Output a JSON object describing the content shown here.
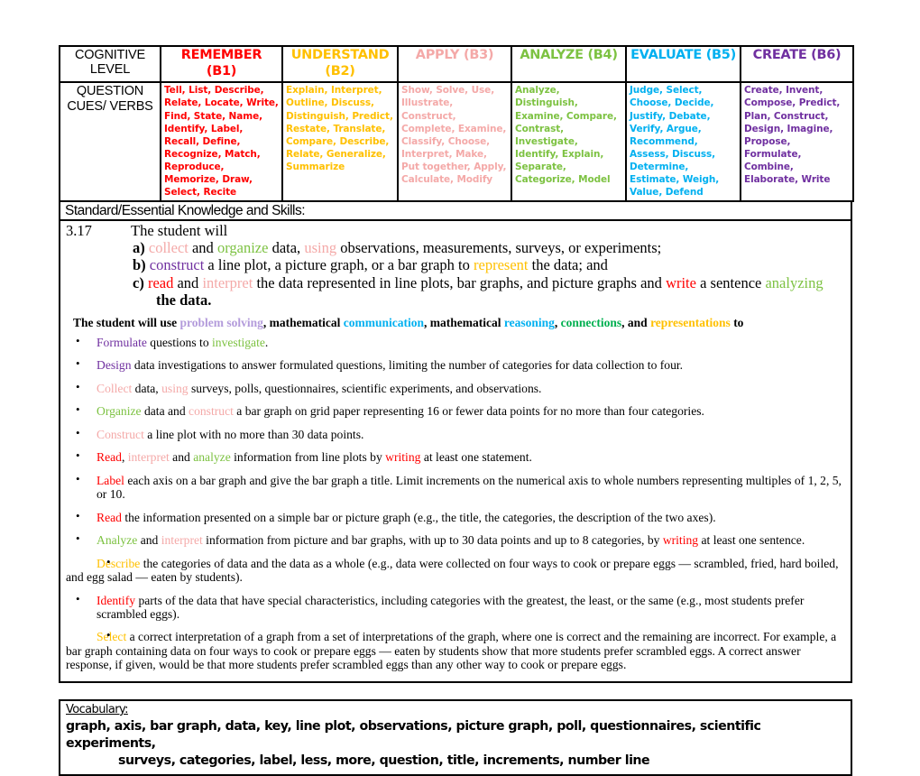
{
  "colors": {
    "remember": "#FF0000",
    "understand": "#FFC000",
    "apply": "#F4A9A8",
    "analyze": "#7DC242",
    "evaluate": "#00B0F0",
    "create": "#7030A0",
    "problem_solving": "#B39BDB",
    "connections": "#00B050"
  },
  "bloom_table": {
    "row_labels": {
      "cognitive_level": "COGNITIVE LEVEL",
      "question_cues": "QUESTION CUES/ VERBS"
    },
    "columns": [
      {
        "header": "REMEMBER (B1)",
        "color_key": "remember",
        "cues": "Tell, List, Describe, Relate, Locate, Write, Find, State, Name, Identify, Label, Recall, Define, Recognize, Match, Reproduce, Memorize, Draw, Select, Recite"
      },
      {
        "header": "UNDERSTAND (B2)",
        "color_key": "understand",
        "cues": "Explain, Interpret, Outline, Discuss, Distinguish, Predict, Restate, Translate, Compare, Describe, Relate, Generalize, Summarize"
      },
      {
        "header": "APPLY (B3)",
        "color_key": "apply",
        "cues": "Show, Solve, Use, Illustrate, Construct, Complete, Examine, Classify, Choose, Interpret, Make, Put together, Apply, Calculate, Modify"
      },
      {
        "header": "ANALYZE (B4)",
        "color_key": "analyze",
        "cues": "Analyze, Distinguish, Examine, Compare, Contrast, Investigate, Identify, Explain, Separate, Categorize, Model"
      },
      {
        "header": "EVALUATE (B5)",
        "color_key": "evaluate",
        "cues": "Judge, Select, Choose, Decide, Justify, Debate, Verify, Argue, Recommend, Assess, Discuss, Determine, Estimate, Weigh, Value, Defend"
      },
      {
        "header": "CREATE (B6)",
        "color_key": "create",
        "cues": "Create, Invent, Compose, Predict, Plan, Construct, Design, Imagine, Propose, Formulate, Combine, Elaborate, Write"
      }
    ]
  },
  "standard": {
    "title": "Standard/Essential Knowledge and Skills:",
    "number": "3.17",
    "stem": "The student will",
    "items": [
      {
        "label": "a)",
        "text": "collect and organize data, using observations, measurements, surveys, or experiments;"
      },
      {
        "label": "b)",
        "text": "construct a line plot, a picture graph, or a bar graph to represent the data; and"
      },
      {
        "label": "c)",
        "text": "read and interpret the data represented in line plots, bar graphs, and picture graphs and write a sentence analyzing the data."
      }
    ],
    "continuation": "the data.",
    "use_line": "The student will use problem solving, mathematical communication, mathematical reasoning, connections, and representations to",
    "skills": [
      "Formulate questions to investigate.",
      "Design data investigations to answer formulated questions, limiting the number of categories for data collection to four.",
      "Collect data, using surveys, polls, questionnaires, scientific experiments, and observations.",
      "Organize data and construct a bar graph on grid paper representing 16 or fewer data points for no more than four categories.",
      "Construct a line plot with no more than 30 data points.",
      "Read, interpret and analyze information from line plots by writing at least one statement.",
      "Label each axis on a bar graph and give the bar graph a title. Limit increments on the numerical axis to whole numbers representing multiples of 1, 2, 5, or 10.",
      "Read the information presented on a simple bar or picture graph (e.g., the title, the categories, the description of the two axes).",
      "Analyze and interpret information from picture and bar graphs, with up to 30 data points and up to 8 categories, by writing at least one sentence.",
      "Describe the categories of data and the data as a whole (e.g., data were collected on four ways to cook or prepare eggs — scrambled, fried, hard boiled, and egg salad — eaten by students).",
      "Identify parts of the data that have special characteristics, including categories with the greatest, the least, or the same (e.g., most students prefer scrambled eggs).",
      "Select a correct interpretation of a graph from a set of interpretations of the graph, where one is correct and the remaining are incorrect. For example, a bar graph containing data on four ways to cook or prepare eggs — eaten by students show that more students prefer scrambled eggs. A correct answer response, if given, would be that more students prefer scrambled eggs than any other way to cook or prepare eggs."
    ]
  },
  "vocabulary": {
    "title": "Vocabulary:",
    "line1": "graph, axis, bar graph, data, key, line plot, observations, picture graph, poll, questionnaires, scientific experiments,",
    "line2": "surveys, categories, label, less, more, question, title, increments, number line"
  }
}
